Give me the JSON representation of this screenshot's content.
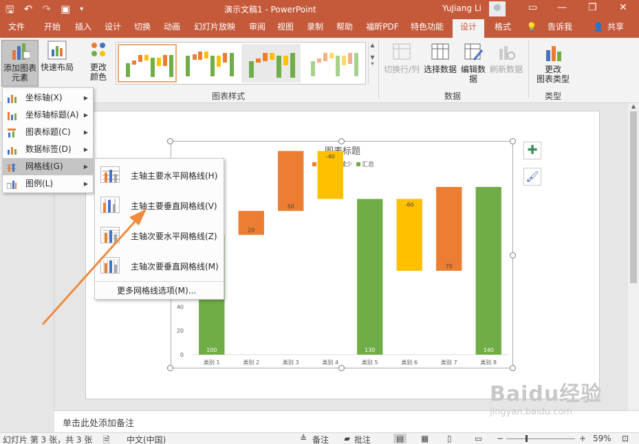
{
  "titlebar": {
    "doc_title": "演示文稿1  -  PowerPoint",
    "user": "YuJiang Li",
    "qat": [
      "save-icon",
      "undo-icon",
      "redo-icon",
      "present-icon",
      "customize-icon"
    ],
    "window_controls": [
      "—",
      "❐",
      "✕"
    ]
  },
  "tabs": [
    "文件",
    "开始",
    "插入",
    "设计",
    "切换",
    "动画",
    "幻灯片放映",
    "审阅",
    "视图",
    "录制",
    "帮助",
    "福昕PDF",
    "特色功能",
    "设计",
    "格式",
    "告诉我",
    "共享"
  ],
  "ribbon": {
    "add_element": "添加图表\n元素",
    "quick_layout": "快速布局",
    "change_color": "更改\n颜色",
    "chart_styles_label": "图表样式",
    "switch_row_col": "切换行/列",
    "select_data": "选择数据",
    "edit_data": "编辑数\n据",
    "refresh_data": "刷新数据",
    "data_label": "数据",
    "change_type": "更改\n图表类型",
    "type_label": "类型"
  },
  "menu": {
    "items": [
      {
        "label": "坐标轴(X)",
        "icon": "axis-icon"
      },
      {
        "label": "坐标轴标题(A)",
        "icon": "axis-title-icon"
      },
      {
        "label": "图表标题(C)",
        "icon": "chart-title-icon"
      },
      {
        "label": "数据标签(D)",
        "icon": "data-label-icon"
      },
      {
        "label": "网格线(G)",
        "icon": "gridlines-icon"
      },
      {
        "label": "图例(L)",
        "icon": "legend-icon"
      }
    ],
    "submenu": [
      "主轴主要水平网格线(H)",
      "主轴主要垂直网格线(V)",
      "主轴次要水平网格线(Z)",
      "主轴次要垂直网格线(M)"
    ],
    "submenu_more": "更多网格线选项(M)..."
  },
  "chart_data": {
    "type": "bar",
    "subtype": "waterfall",
    "title": "图表标题",
    "legend": [
      "增加",
      "减少",
      "汇总"
    ],
    "legend_position": "top",
    "categories": [
      "类别 1",
      "类别 2",
      "类别 3",
      "类别 4",
      "类别 5",
      "类别 6",
      "类别 7",
      "类别 8"
    ],
    "values": [
      100,
      20,
      50,
      -40,
      130,
      -60,
      70,
      140
    ],
    "kinds": [
      "汇总",
      "增加",
      "增加",
      "减少",
      "汇总",
      "减少",
      "增加",
      "汇总"
    ],
    "y_ticks_visible": [
      "0",
      "20",
      "40"
    ],
    "ylim": [
      0,
      140
    ],
    "colors": {
      "增加": "#ed7d31",
      "减少": "#ffc000",
      "汇总": "#70ad47"
    }
  },
  "notes_placeholder": "单击此处添加备注",
  "status": {
    "slide": "幻灯片 第 3 张，共 3 张",
    "language": "中文(中国)",
    "notes": "备注",
    "comments": "批注",
    "zoom": "59%"
  },
  "watermark": {
    "brand": "Baidu经验",
    "url": "jingyan.baidu.com"
  }
}
